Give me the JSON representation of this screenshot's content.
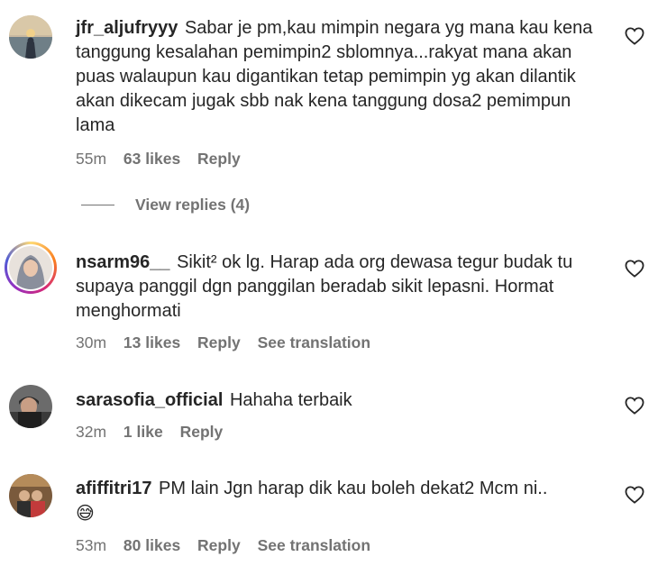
{
  "comments": [
    {
      "username": "jfr_aljufryyy",
      "text": "Sabar je pm,kau mimpin negara yg mana kau kena tanggung kesalahan pemimpin2 sblomnya...rakyat mana akan puas walaupun kau digantikan tetap pemimpin yg akan dilantik akan dikecam jugak sbb nak kena tanggung dosa2 pemimpun lama",
      "time": "55m",
      "likes": "63 likes",
      "reply": "Reply"
    },
    {
      "username": "nsarm96__",
      "text": "Sikit² ok lg. Harap ada org dewasa tegur budak tu supaya panggil dgn panggilan beradab sikit lepasni. Hormat menghormati",
      "time": "30m",
      "likes": "13 likes",
      "reply": "Reply",
      "translation": "See translation"
    },
    {
      "username": "sarasofia_official",
      "text": "Hahaha terbaik",
      "time": "32m",
      "likes": "1 like",
      "reply": "Reply"
    },
    {
      "username": "afiffitri17",
      "text": "PM lain Jgn harap dik kau boleh dekat2 Mcm ni..",
      "emoji": "😅",
      "time": "53m",
      "likes": "80 likes",
      "reply": "Reply",
      "translation": "See translation"
    }
  ],
  "view_replies": "View replies (4)",
  "icons": {
    "like": "heart-outline-icon"
  }
}
